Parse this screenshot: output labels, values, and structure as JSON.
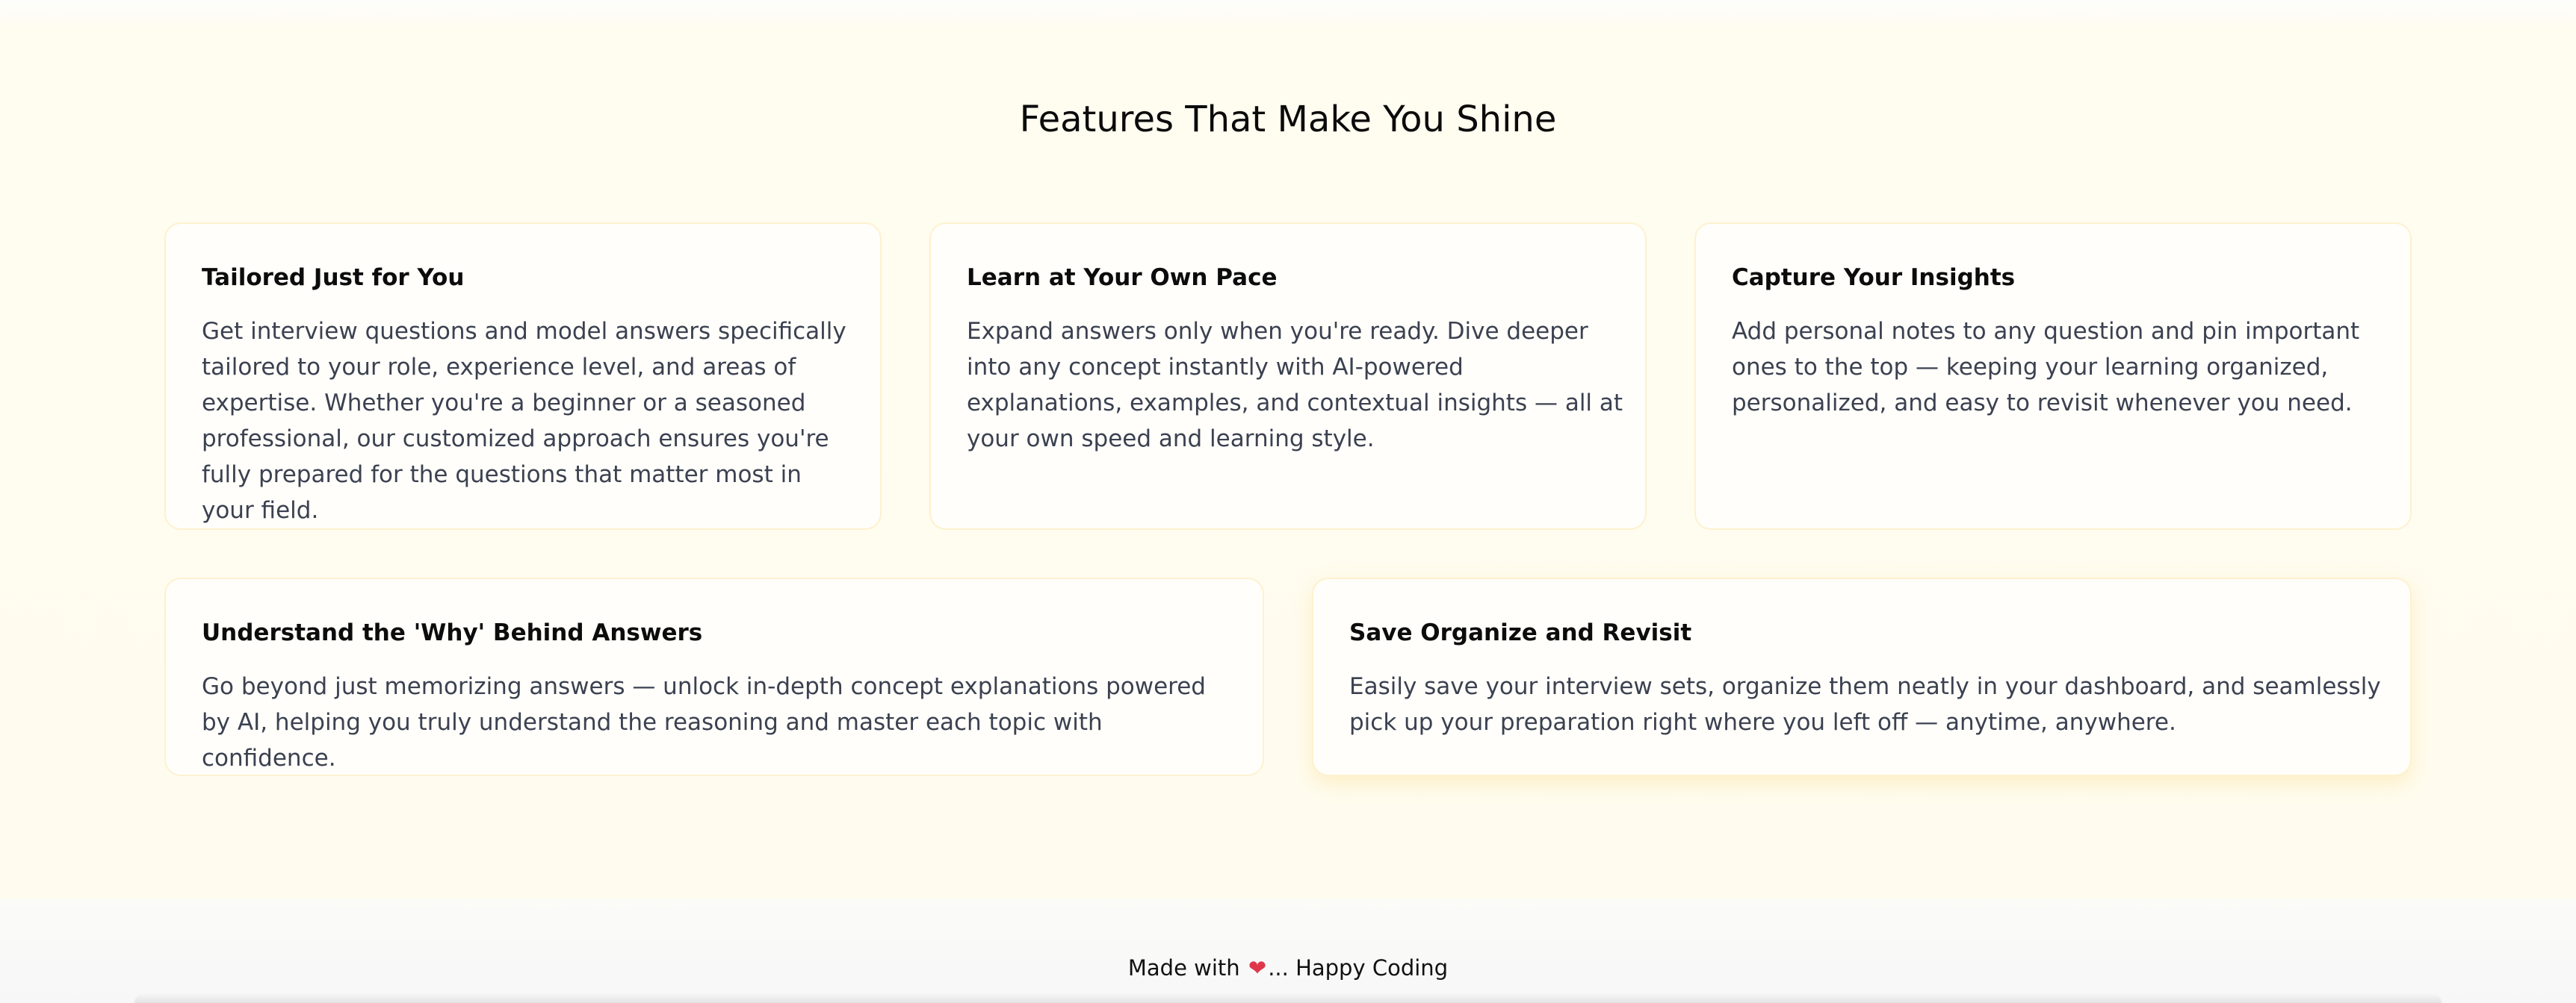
{
  "features": {
    "title": "Features That Make You Shine",
    "cards": [
      {
        "title": "Tailored Just for You",
        "description": "Get interview questions and model answers specifically tailored to your role, experience level, and areas of expertise. Whether you're a beginner or a seasoned professional, our customized approach ensures you're fully prepared for the questions that matter most in your field."
      },
      {
        "title": "Learn at Your Own Pace",
        "description": "Expand answers only when you're ready. Dive deeper into any concept instantly with AI-powered explanations, examples, and contextual insights — all at your own speed and learning style."
      },
      {
        "title": "Capture Your Insights",
        "description": "Add personal notes to any question and pin important ones to the top — keeping your learning organized, personalized, and easy to revisit whenever you need."
      },
      {
        "title": "Understand the 'Why' Behind Answers",
        "description": "Go beyond just memorizing answers — unlock in-depth concept explanations powered by AI, helping you truly understand the reasoning and master each topic with confidence."
      },
      {
        "title": "Save Organize and Revisit",
        "description": "Easily save your interview sets, organize them neatly in your dashboard, and seamlessly pick up your preparation right where you left off — anytime, anywhere."
      }
    ]
  },
  "footer": {
    "prefix": "Made with",
    "heart": "❤",
    "suffix": "... Happy Coding"
  },
  "colors": {
    "page_background": "#fffcef",
    "card_background": "#fffefa",
    "card_border": "#fdf1cf",
    "body_text": "#3b4150",
    "heart": "#e0364a"
  }
}
